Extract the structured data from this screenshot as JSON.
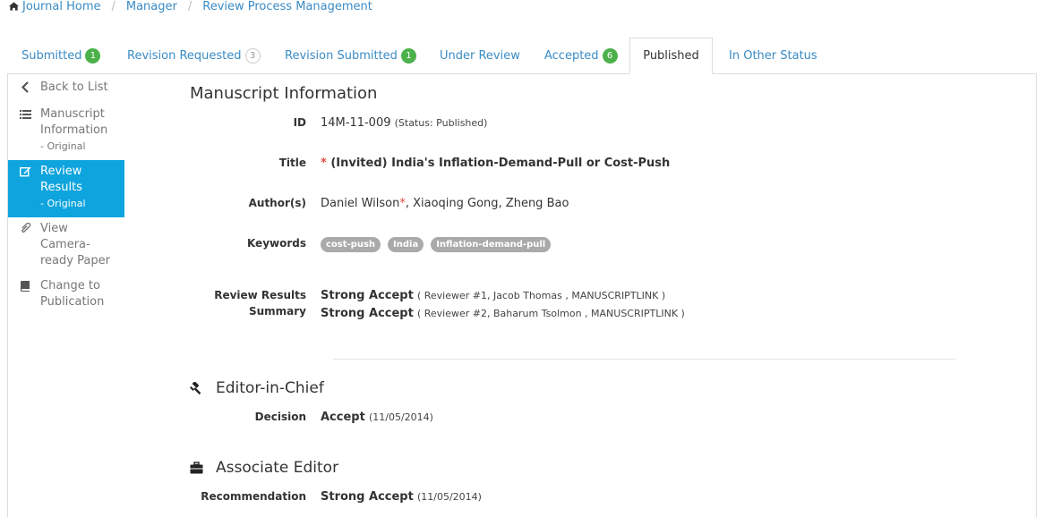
{
  "breadcrumb": [
    "Journal Home",
    "Manager",
    "Review Process Management"
  ],
  "tabs": {
    "submitted": {
      "label": "Submitted",
      "count": "1"
    },
    "revision_requested": {
      "label": "Revision Requested",
      "count": "3"
    },
    "revision_submitted": {
      "label": "Revision Submitted",
      "count": "1"
    },
    "under_review": {
      "label": "Under Review"
    },
    "accepted": {
      "label": "Accepted",
      "count": "6"
    },
    "published": {
      "label": "Published"
    },
    "other": {
      "label": "In Other Status"
    }
  },
  "sidebar": {
    "back": "Back to List",
    "manuscript": {
      "label": "Manuscript Information",
      "sub": "- Original"
    },
    "review": {
      "label": "Review Results",
      "sub": "- Original"
    },
    "camera": "View Camera-ready Paper",
    "change": "Change to Publication"
  },
  "manuscript": {
    "title": "Manuscript Information",
    "id_label": "ID",
    "id_value": "14M-11-009",
    "id_status": "(Status: Published)",
    "title_label": "Title",
    "title_required": "*",
    "title_value": "(Invited) India's Inflation-Demand-Pull or Cost-Push",
    "authors_label": "Author(s)",
    "author_first": "Daniel Wilson",
    "author_mark": "*",
    "author_rest": ", Xiaoqing Gong, Zheng Bao",
    "keywords_label": "Keywords",
    "keywords": [
      "cost-push",
      "India",
      "Inflation-demand-pull"
    ],
    "review_label_1": "Review Results",
    "review_label_2": "Summary",
    "reviews": [
      {
        "decision": "Strong Accept",
        "detail": "( Reviewer #1, Jacob Thomas , MANUSCRIPTLINK )"
      },
      {
        "decision": "Strong Accept",
        "detail": "( Reviewer #2, Baharum Tsolmon , MANUSCRIPTLINK )"
      }
    ]
  },
  "editor_in_chief": {
    "title": "Editor-in-Chief",
    "decision_label": "Decision",
    "decision": "Accept",
    "date": "(11/05/2014)"
  },
  "associate_editor": {
    "title": "Associate Editor",
    "recommendation_label": "Recommendation",
    "recommendation": "Strong Accept",
    "date": "(11/05/2014)"
  },
  "colors": {
    "link": "#3a8bc5",
    "active": "#0ea4dd",
    "badge": "#4cb14b",
    "required": "#e24b3f"
  }
}
